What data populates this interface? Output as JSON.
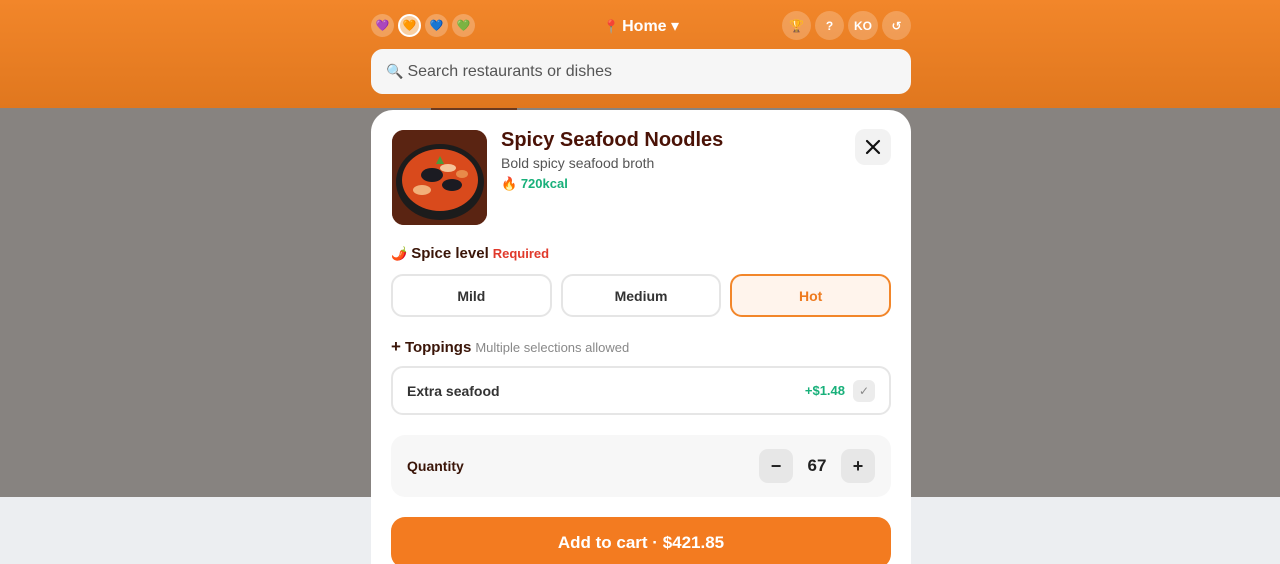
{
  "header": {
    "profile_dots": [
      "💜",
      "🧡",
      "💙",
      "💚"
    ],
    "location": "Home",
    "location_pin": "📍",
    "location_caret": "▾",
    "right_buttons": [
      "🏆",
      "?",
      "KO",
      "↺"
    ],
    "search_icon": "🔍",
    "search_placeholder": "Search restaurants or dishes"
  },
  "modal": {
    "title": "Spicy Seafood Noodles",
    "subtitle": "Bold spicy seafood broth",
    "kcal_icon": "🔥",
    "kcal": "720kcal",
    "close_icon": "close-icon",
    "spice": {
      "icon": "🌶️",
      "label": "Spice level",
      "required": "Required",
      "options": [
        "Mild",
        "Medium",
        "Hot"
      ],
      "selected": "Hot"
    },
    "toppings": {
      "icon": "+",
      "label": "Toppings",
      "note": "Multiple selections allowed",
      "items": [
        {
          "name": "Extra seafood",
          "price": "+$1.48",
          "checked": false
        }
      ]
    },
    "quantity": {
      "label": "Quantity",
      "value": "67",
      "minus": "−",
      "plus": "+"
    },
    "cart_button": "Add to cart · $421.85"
  },
  "colors": {
    "accent": "#f37b20",
    "price_green": "#18b07a",
    "required_red": "#e0392b"
  }
}
